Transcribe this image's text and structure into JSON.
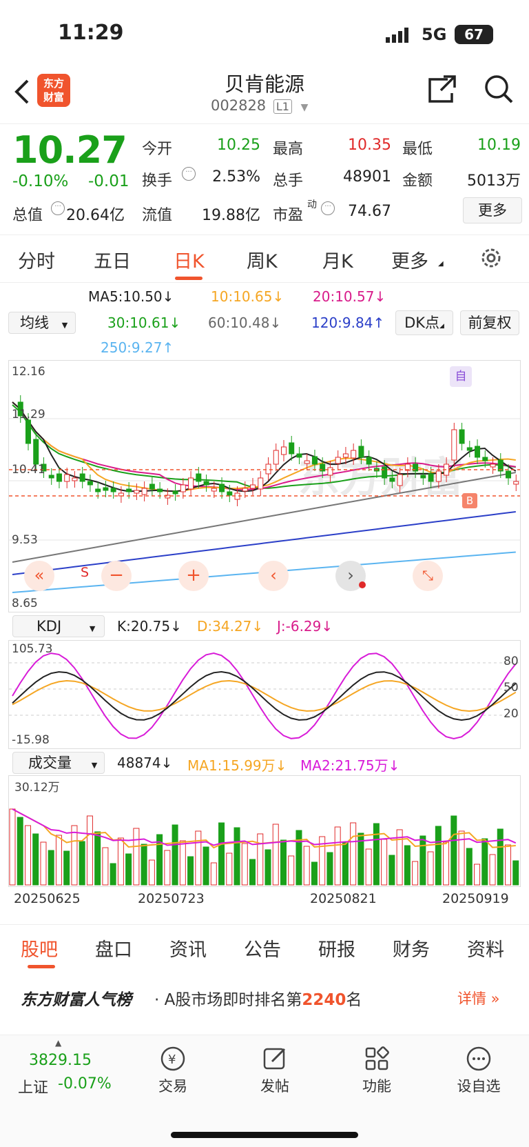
{
  "status_bar": {
    "time": "11:29",
    "network": "5G",
    "battery": "67"
  },
  "header": {
    "logo_line1": "东方",
    "logo_line2": "财富",
    "title": "贝肯能源",
    "code": "002828",
    "level": "L1"
  },
  "quote": {
    "price": "10.27",
    "change_pct": "-0.10%",
    "change": "-0.01",
    "open_label": "今开",
    "open": "10.25",
    "high_label": "最高",
    "high": "10.35",
    "low_label": "最低",
    "low": "10.19",
    "turnover_label": "换手",
    "turnover": "2.53%",
    "volume_label": "总手",
    "volume": "48901",
    "amount_label": "金额",
    "amount": "5013万",
    "mktcap_label": "总值",
    "mktcap": "20.64亿",
    "float_label": "流值",
    "float": "19.88亿",
    "pe_label": "市盈",
    "pe_super": "动",
    "pe": "74.67",
    "more_button": "更多"
  },
  "period_tabs": [
    "分时",
    "五日",
    "日K",
    "周K",
    "月K",
    "更多"
  ],
  "active_tab": "日K",
  "ma_lines": {
    "selector": "均线",
    "ma5": "MA5:10.50↓",
    "ma10": "10:10.65↓",
    "ma20": "20:10.57↓",
    "ma30": "30:10.61↓",
    "ma60": "60:10.48↓",
    "ma120": "120:9.84↑",
    "ma250": "250:9.27↑",
    "dk_button": "DK点",
    "adjust_button": "前复权"
  },
  "kline_chart": {
    "y_labels": [
      "12.16",
      "11.29",
      "10.41",
      "9.53",
      "8.65"
    ],
    "marker_top": "自",
    "marker_b": "B",
    "marker_s": "S"
  },
  "kdj": {
    "selector": "KDJ",
    "k": "K:20.75↓",
    "d": "D:34.27↓",
    "j": "J:-6.29↓",
    "y_top": "105.73",
    "y_bottom": "-15.98",
    "levels": [
      "80",
      "50",
      "20"
    ]
  },
  "volume": {
    "selector": "成交量",
    "current": "48874↓",
    "ma1": "MA1:15.99万↓",
    "ma2": "MA2:21.75万↓",
    "y_top": "30.12万"
  },
  "dates": [
    "20250625",
    "20250723",
    "20250821",
    "20250919"
  ],
  "bottom_tabs": [
    "股吧",
    "盘口",
    "资讯",
    "公告",
    "研报",
    "财务",
    "资料"
  ],
  "ranking": {
    "brand": "东方财富人气榜",
    "text_pre": "· A股市场即时排名第",
    "rank": "2240",
    "text_post": "名",
    "detail": "详情"
  },
  "footer": {
    "index_value": "3829.15",
    "index_name": "上证",
    "index_change": "-0.07%",
    "items": [
      "交易",
      "发帖",
      "功能",
      "设自选"
    ]
  },
  "colors": {
    "up": "#e02a2a",
    "down": "#1aa01a",
    "brand": "#f0542d"
  }
}
